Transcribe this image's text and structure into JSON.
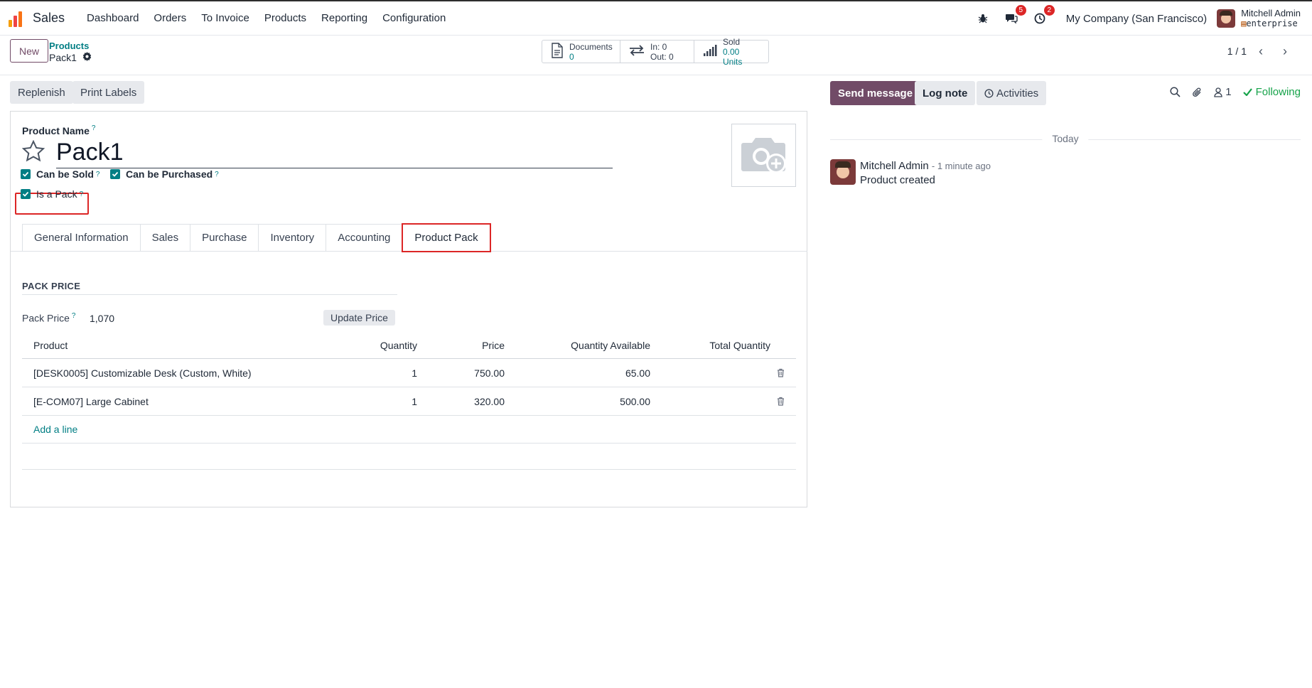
{
  "navbar": {
    "app_name": "Sales",
    "menu": [
      "Dashboard",
      "Orders",
      "To Invoice",
      "Products",
      "Reporting",
      "Configuration"
    ],
    "messages_count": "5",
    "activities_count": "2",
    "company": "My Company (San Francisco)",
    "user_name": "Mitchell Admin",
    "database": "enterprise"
  },
  "control_panel": {
    "new_label": "New",
    "breadcrumb_parent": "Products",
    "breadcrumb_current": "Pack1",
    "stats": {
      "documents_label": "Documents",
      "documents_value": "0",
      "in_label": "In: 0",
      "out_label": "Out: 0",
      "sold_label": "Sold",
      "sold_value": "0.00 Units"
    },
    "pager": "1 / 1"
  },
  "actions": {
    "replenish": "Replenish",
    "print_labels": "Print Labels"
  },
  "form": {
    "product_name_label": "Product Name",
    "help_mark": "?",
    "product_name": "Pack1",
    "can_be_sold": "Can be Sold",
    "can_be_purchased": "Can be Purchased",
    "is_a_pack": "Is a Pack",
    "tabs": [
      "General Information",
      "Sales",
      "Purchase",
      "Inventory",
      "Accounting",
      "Product Pack"
    ],
    "active_tab": "Product Pack",
    "section_title": "PACK PRICE",
    "pack_price_label": "Pack Price",
    "pack_price_value": "1,070",
    "update_price": "Update Price",
    "table": {
      "headers": [
        "Product",
        "Quantity",
        "Price",
        "Quantity Available",
        "Total Quantity"
      ],
      "rows": [
        {
          "product": "[DESK0005] Customizable Desk (Custom, White)",
          "quantity": "1",
          "price": "750.00",
          "available": "65.00",
          "total": ""
        },
        {
          "product": "[E-COM07] Large Cabinet",
          "quantity": "1",
          "price": "320.00",
          "available": "500.00",
          "total": ""
        }
      ],
      "add_line": "Add a line"
    }
  },
  "chatter": {
    "send_message": "Send message",
    "log_note": "Log note",
    "activities": "Activities",
    "followers_count": "1",
    "following": "Following",
    "date_separator": "Today",
    "message": {
      "author": "Mitchell Admin",
      "time": "- 1 minute ago",
      "text": "Product created"
    }
  },
  "colors": {
    "brand": "#714b67",
    "accent": "#017e84",
    "highlight": "#dc2626"
  }
}
